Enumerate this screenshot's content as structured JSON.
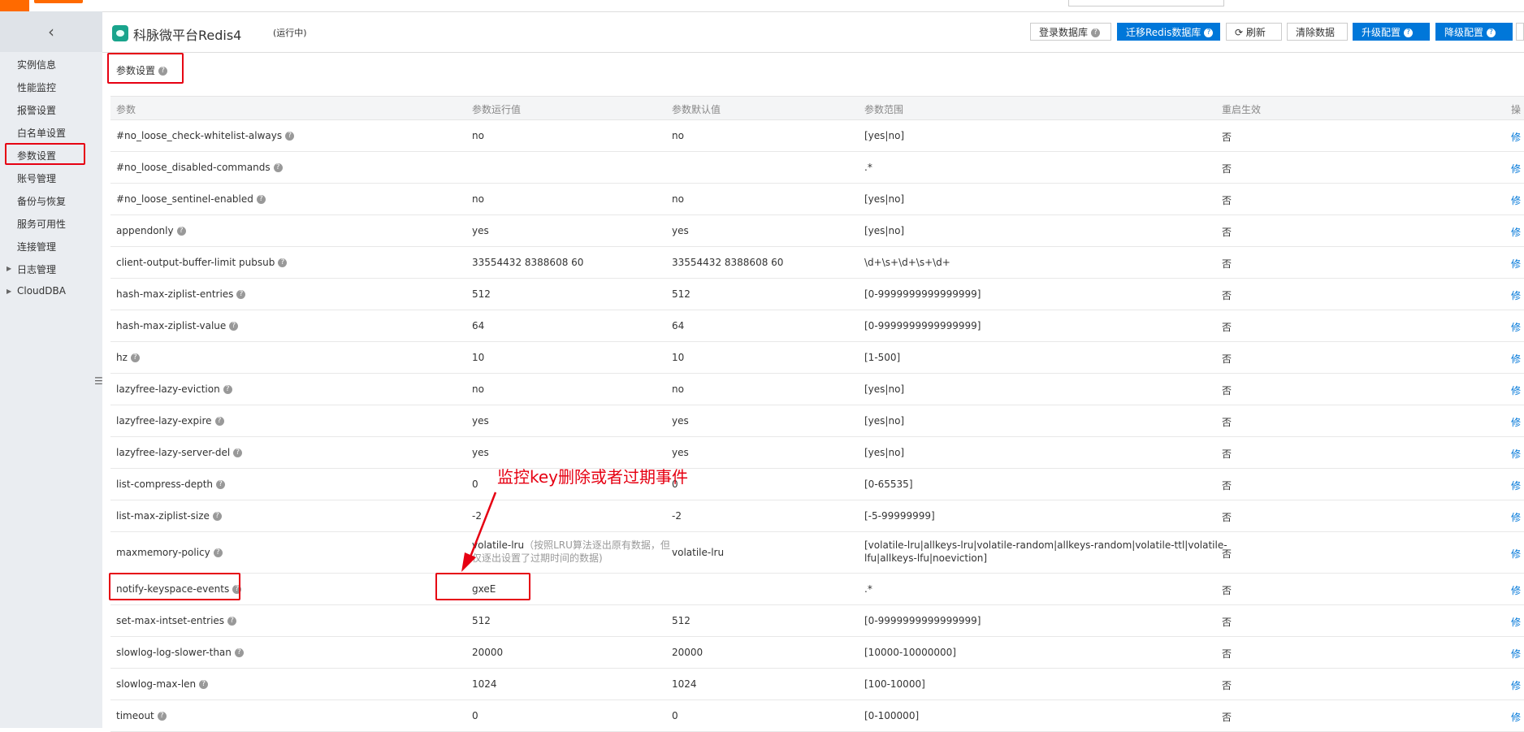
{
  "sidebar": {
    "collapse_icon": "chevron-left-icon",
    "items": [
      {
        "label": "实例信息"
      },
      {
        "label": "性能监控"
      },
      {
        "label": "报警设置"
      },
      {
        "label": "白名单设置"
      },
      {
        "label": "参数设置",
        "active": true
      },
      {
        "label": "账号管理"
      },
      {
        "label": "备份与恢复"
      },
      {
        "label": "服务可用性"
      },
      {
        "label": "连接管理"
      },
      {
        "label": "日志管理",
        "expandable": true
      },
      {
        "label": "CloudDBA",
        "expandable": true
      }
    ]
  },
  "header": {
    "title": "科脉微平台Redis4",
    "status": "(运行中)",
    "buttons": {
      "login_db": "登录数据库",
      "migrate": "迁移Redis数据库",
      "refresh": "刷新",
      "clear": "清除数据",
      "upgrade": "升级配置",
      "downgrade": "降级配置"
    }
  },
  "section": {
    "title": "参数设置"
  },
  "table": {
    "columns": [
      "参数",
      "参数运行值",
      "参数默认值",
      "参数范围",
      "重启生效",
      "操"
    ],
    "edit_label": "修",
    "rows": [
      {
        "name": "#no_loose_check-whitelist-always",
        "running": "no",
        "default": "no",
        "range": "[yes|no]",
        "restart": "否"
      },
      {
        "name": "#no_loose_disabled-commands",
        "running": "",
        "default": "",
        "range": ".*",
        "restart": "否"
      },
      {
        "name": "#no_loose_sentinel-enabled",
        "running": "no",
        "default": "no",
        "range": "[yes|no]",
        "restart": "否"
      },
      {
        "name": "appendonly",
        "running": "yes",
        "default": "yes",
        "range": "[yes|no]",
        "restart": "否"
      },
      {
        "name": "client-output-buffer-limit pubsub",
        "running": "33554432 8388608 60",
        "default": "33554432 8388608 60",
        "range": "\\d+\\s+\\d+\\s+\\d+",
        "restart": "否"
      },
      {
        "name": "hash-max-ziplist-entries",
        "running": "512",
        "default": "512",
        "range": "[0-9999999999999999]",
        "restart": "否"
      },
      {
        "name": "hash-max-ziplist-value",
        "running": "64",
        "default": "64",
        "range": "[0-9999999999999999]",
        "restart": "否"
      },
      {
        "name": "hz",
        "running": "10",
        "default": "10",
        "range": "[1-500]",
        "restart": "否"
      },
      {
        "name": "lazyfree-lazy-eviction",
        "running": "no",
        "default": "no",
        "range": "[yes|no]",
        "restart": "否"
      },
      {
        "name": "lazyfree-lazy-expire",
        "running": "yes",
        "default": "yes",
        "range": "[yes|no]",
        "restart": "否"
      },
      {
        "name": "lazyfree-lazy-server-del",
        "running": "yes",
        "default": "yes",
        "range": "[yes|no]",
        "restart": "否"
      },
      {
        "name": "list-compress-depth",
        "running": "0",
        "default": "0",
        "range": "[0-65535]",
        "restart": "否"
      },
      {
        "name": "list-max-ziplist-size",
        "running": "-2",
        "default": "-2",
        "range": "[-5-99999999]",
        "restart": "否"
      },
      {
        "name": "maxmemory-policy",
        "running": "volatile-lru",
        "running_note_1": "（按照LRU算法逐出原有数据，但",
        "running_note_2": "仅逐出设置了过期时间的数据)",
        "default": "volatile-lru",
        "range": "[volatile-lru|allkeys-lru|volatile-random|allkeys-random|volatile-ttl|volatile-",
        "range_2": "lfu|allkeys-lfu|noeviction]",
        "restart": "否"
      },
      {
        "name": "notify-keyspace-events",
        "running": "gxeE",
        "default": "",
        "range": ".*",
        "restart": "否"
      },
      {
        "name": "set-max-intset-entries",
        "running": "512",
        "default": "512",
        "range": "[0-9999999999999999]",
        "restart": "否"
      },
      {
        "name": "slowlog-log-slower-than",
        "running": "20000",
        "default": "20000",
        "range": "[10000-10000000]",
        "restart": "否"
      },
      {
        "name": "slowlog-max-len",
        "running": "1024",
        "default": "1024",
        "range": "[100-10000]",
        "restart": "否"
      },
      {
        "name": "timeout",
        "running": "0",
        "default": "0",
        "range": "[0-100000]",
        "restart": "否"
      }
    ]
  },
  "annotation": {
    "text": "监控key删除或者过期事件",
    "color": "#e60012"
  }
}
